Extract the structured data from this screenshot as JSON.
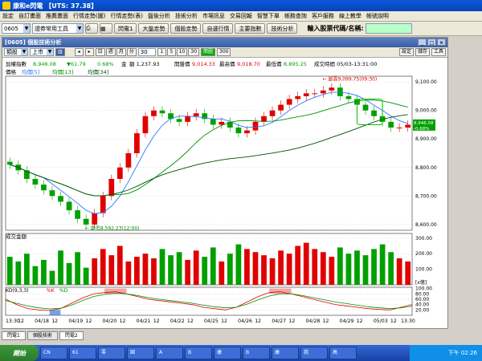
{
  "titlebar": {
    "title": "康和e閃電 【UTS: 37.38】"
  },
  "menu": [
    "設定",
    "自訂畫面",
    "推薦畫面",
    "行情走勢(圖)",
    "行情走勢(表)",
    "盤後分析",
    "技術分析",
    "市場訊息",
    "交易回報",
    "智慧下單",
    "帳務查詢",
    "客戶服務",
    "線上教學",
    "帳號說明"
  ],
  "toolbar": {
    "symbol": "0605",
    "tool_combo": "證券常用工具",
    "buttons": [
      "閃電1",
      "大盤走勢",
      "個股走勢",
      "自選行情",
      "主要指數",
      "技術分析"
    ],
    "search_label": "輸入股票代碼/名稱:"
  },
  "doc": {
    "title": "[0605] 個股技術分析",
    "controls": [
      "_",
      "□",
      "×"
    ],
    "period_combo": "類股",
    "market_combo": "上市",
    "period_btns": [
      "日",
      "週",
      "月",
      "分"
    ],
    "num_combo": "30",
    "interval_btns": [
      "1",
      "5",
      "10",
      "30"
    ],
    "cur_btn": "簡圖",
    "cur_num": "300",
    "right_btns": [
      "設定",
      "儲存",
      "工具"
    ]
  },
  "info_row": {
    "name": "加權指數",
    "price": "8,946.08",
    "change": "▼61.79",
    "pct": "0.68%",
    "amt_label": "金",
    "amount": "額 1,237.93",
    "open_label": "開盤價",
    "open": "9,014.33",
    "high_label": "最高價",
    "high": "9,018.70",
    "low_label": "最低價",
    "low": "8,895.25",
    "time": "成交時間 05/03-13:31:00"
  },
  "legend_price": [
    "價格",
    "均價[5]",
    "均價[13]",
    "均價[34]"
  ],
  "legend_vol": "成交金額",
  "legend_kd": [
    "KD(9,3,3)",
    "%K",
    "%D"
  ],
  "annotations": {
    "high": "最高9,099.75(09:30)",
    "low": "最低8,592.23(12:00)"
  },
  "current_price": "8,946.08",
  "current_pct": "-0.68%",
  "price_axis": [
    "9,100.00",
    "9,000.00",
    "8,900.00",
    "8,800.00",
    "8,700.00",
    "8,600.00"
  ],
  "vol_axis": [
    "300.00",
    "200.00",
    "100.00",
    "[x億]"
  ],
  "kd_axis": [
    "100.00",
    "80.00",
    "60.00",
    "40.00",
    "20.00"
  ],
  "x_labels": [
    "13:30",
    "12",
    "04/18",
    "12",
    "04/19",
    "12",
    "04/20",
    "12",
    "04/21",
    "12",
    "04/22",
    "12",
    "04/25",
    "12",
    "04/26",
    "12",
    "04/27",
    "12",
    "04/28",
    "12",
    "04/29",
    "12",
    "05/03",
    "12",
    "13:30"
  ],
  "doc_tabs": [
    "閃電1",
    "個股技術",
    "閃電2"
  ],
  "taskbar": {
    "start": "開始",
    "tasks": [
      "CN",
      "61",
      "零",
      "國",
      "A",
      "B",
      "康",
      "B",
      "康",
      "我",
      "高"
    ],
    "clock": "下午 02:26"
  },
  "colors": {
    "up": "#e00000",
    "down": "#00a000",
    "ma5": "#2b7bff",
    "ma13": "#009000",
    "ma34": "#005000"
  },
  "chart_data": {
    "type": "line",
    "price_candles_close": [
      8810,
      8790,
      8760,
      8740,
      8720,
      8700,
      8680,
      8650,
      8620,
      8600,
      8640,
      8700,
      8760,
      8800,
      8850,
      8920,
      8980,
      9000,
      8990,
      8970,
      8960,
      8980,
      8990,
      8970,
      8950,
      8960,
      8940,
      8920,
      8930,
      8960,
      8980,
      9000,
      9020,
      9040,
      9050,
      9060,
      9060,
      9070,
      9080,
      9050,
      9040,
      9020,
      9000,
      8980,
      8960,
      8940,
      8940,
      8950
    ],
    "volume": [
      180,
      150,
      200,
      120,
      160,
      90,
      220,
      140,
      210,
      110,
      170,
      230,
      190,
      250,
      150,
      180,
      200,
      170,
      230,
      190,
      210,
      160,
      220,
      180,
      240,
      150,
      200,
      260,
      230,
      210,
      190,
      170,
      220,
      200,
      250,
      270,
      230,
      210,
      180,
      240,
      200,
      220,
      190,
      230,
      260,
      210,
      170,
      150
    ],
    "kd_k": [
      60,
      40,
      25,
      20,
      18,
      25,
      45,
      65,
      80,
      85,
      88,
      80,
      70,
      60,
      55,
      50,
      45,
      40,
      30,
      25,
      20,
      30,
      50,
      70,
      85,
      88,
      80,
      70,
      60,
      50,
      40,
      35,
      30,
      25,
      22,
      20,
      30,
      40
    ],
    "kd_d": [
      55,
      45,
      35,
      28,
      24,
      26,
      38,
      55,
      70,
      78,
      82,
      80,
      74,
      66,
      60,
      55,
      50,
      45,
      38,
      32,
      28,
      30,
      42,
      58,
      72,
      80,
      80,
      74,
      66,
      58,
      50,
      44,
      38,
      32,
      28,
      25,
      28,
      34
    ]
  }
}
